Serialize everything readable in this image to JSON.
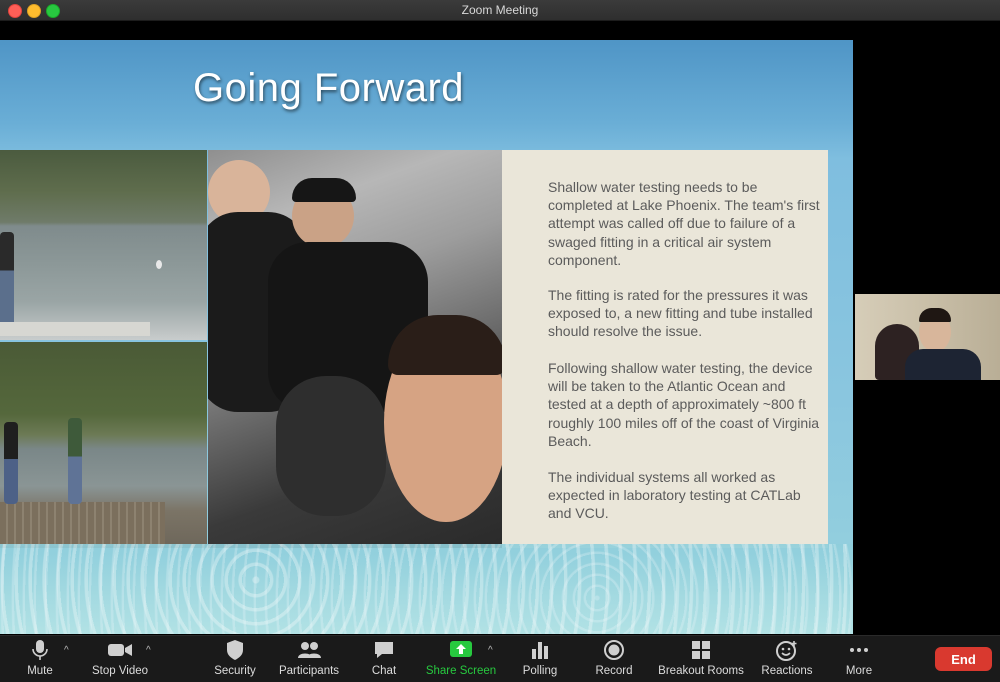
{
  "window": {
    "title": "Zoom Meeting"
  },
  "slide": {
    "title": "Going Forward",
    "paragraphs": [
      "Shallow water testing needs to be completed at Lake Phoenix.  The team's first attempt was called off due to failure of a swaged fitting in a critical air system component.",
      "The fitting is rated for the pressures it was exposed to, a new fitting and tube installed should resolve the issue.",
      "Following shallow water testing, the device will be taken to the Atlantic Ocean and tested at a depth of approximately ~800 ft roughly 100 miles off of the coast of Virginia Beach.",
      "The individual systems all worked as expected in laboratory testing at CATLab and VCU."
    ],
    "colors": {
      "text_box_bg": "#eae6d9",
      "title_color": "#ffffff"
    }
  },
  "toolbar": {
    "mute": "Mute",
    "stop_video": "Stop Video",
    "security": "Security",
    "participants": "Participants",
    "chat": "Chat",
    "share_screen": "Share Screen",
    "polling": "Polling",
    "record": "Record",
    "breakout_rooms": "Breakout Rooms",
    "reactions": "Reactions",
    "more": "More",
    "end": "End",
    "share_color": "#27c93f",
    "end_color": "#d9392f"
  },
  "icons": [
    "microphone-icon",
    "video-camera-icon",
    "shield-icon",
    "participants-icon",
    "chat-bubble-icon",
    "share-screen-icon",
    "polling-icon",
    "record-icon",
    "breakout-rooms-icon",
    "reactions-icon",
    "more-icon",
    "caret-up-icon"
  ]
}
